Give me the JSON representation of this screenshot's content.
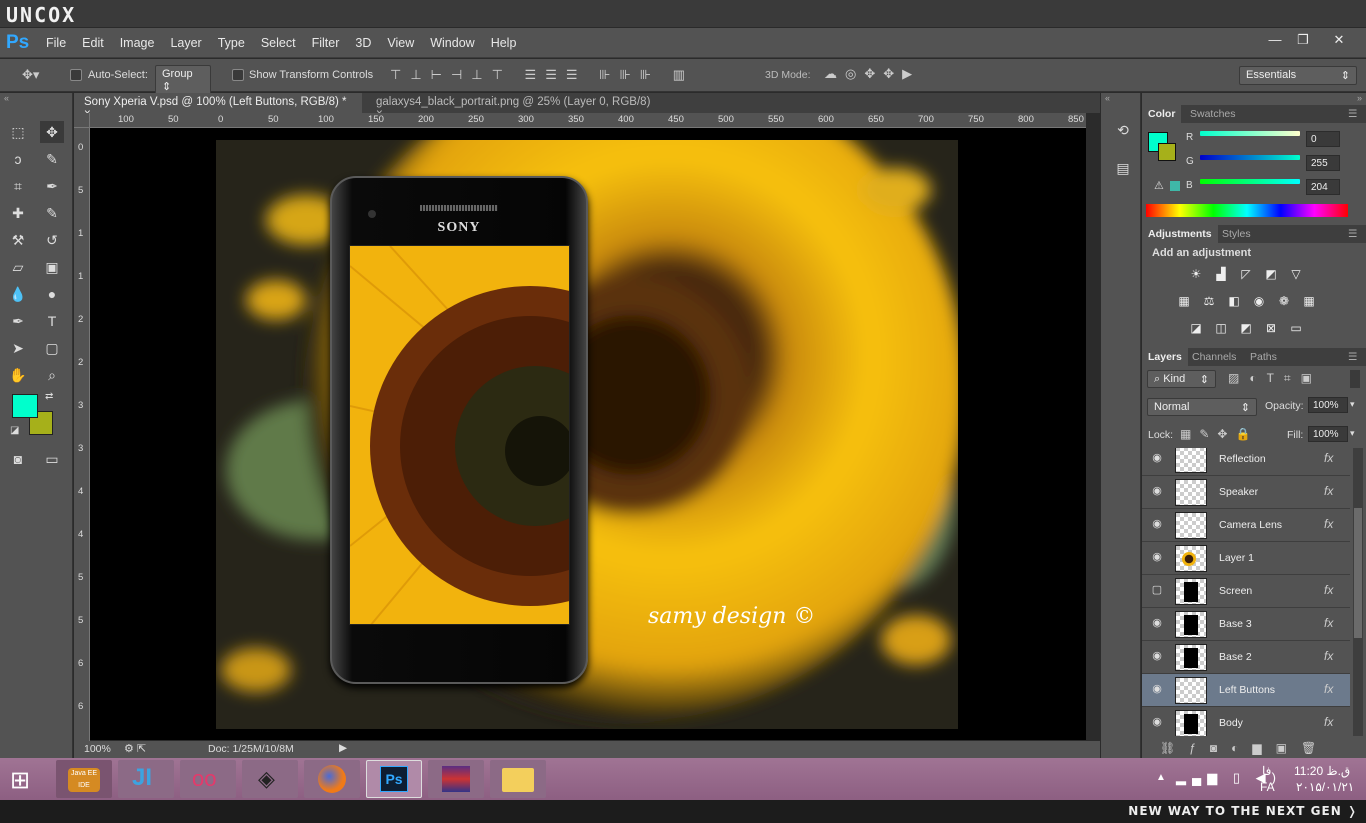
{
  "watermark": {
    "brand": "UNCOX",
    "tagline": "NEW WAY TO THE NEXT GEN"
  },
  "app": {
    "logo": "Ps",
    "menu": [
      "File",
      "Edit",
      "Image",
      "Layer",
      "Type",
      "Select",
      "Filter",
      "3D",
      "View",
      "Window",
      "Help"
    ]
  },
  "options": {
    "auto_select_label": "Auto-Select:",
    "auto_select_value": "Group",
    "transform_label": "Show Transform Controls",
    "mode_3d": "3D Mode:",
    "workspace": "Essentials"
  },
  "tabs": [
    {
      "label": "Sony Xperia V.psd @ 100% (Left Buttons, RGB/8) *"
    },
    {
      "label": "galaxys4_black_portrait.png @ 25% (Layer 0, RGB/8)"
    }
  ],
  "ruler_h": [
    "100",
    "50",
    "0",
    "50",
    "100",
    "150",
    "200",
    "250",
    "300",
    "350",
    "400",
    "450",
    "500",
    "550",
    "600",
    "650",
    "700",
    "750",
    "800",
    "850"
  ],
  "ruler_v": [
    "0",
    "5",
    "1",
    "1",
    "2",
    "2",
    "3",
    "3",
    "4",
    "4",
    "5",
    "5",
    "6",
    "6"
  ],
  "status": {
    "zoom": "100%",
    "doc": "Doc: 1/25M/10/8M"
  },
  "canvas": {
    "phone_brand": "SONY",
    "signature": "samy design ©"
  },
  "color_panel": {
    "tabs": [
      "Color",
      "Swatches"
    ],
    "r_label": "R",
    "g_label": "G",
    "b_label": "B",
    "r": "0",
    "g": "255",
    "b": "204",
    "fg_color": "#00ffcc",
    "bg_color": "#a6b01a"
  },
  "adjust_panel": {
    "tabs": [
      "Adjustments",
      "Styles"
    ],
    "title": "Add an adjustment"
  },
  "layers_panel": {
    "tabs": [
      "Layers",
      "Channels",
      "Paths"
    ],
    "kind": "Kind",
    "blend": "Normal",
    "opacity_label": "Opacity:",
    "opacity": "100%",
    "lock_label": "Lock:",
    "fill_label": "Fill:",
    "fill": "100%",
    "layers": [
      {
        "name": "Reflection",
        "fx": "fx",
        "visible": true
      },
      {
        "name": "Speaker",
        "fx": "fx",
        "visible": true
      },
      {
        "name": "Camera Lens",
        "fx": "fx",
        "visible": true
      },
      {
        "name": "Layer 1",
        "fx": "",
        "visible": true
      },
      {
        "name": "Screen",
        "fx": "fx",
        "visible": false
      },
      {
        "name": "Base 3",
        "fx": "fx",
        "visible": true
      },
      {
        "name": "Base 2",
        "fx": "fx",
        "visible": true
      },
      {
        "name": "Left Buttons",
        "fx": "fx",
        "visible": true
      },
      {
        "name": "Body",
        "fx": "fx",
        "visible": true
      }
    ]
  },
  "taskbar": {
    "time": "11:20 ق.ظ",
    "date": "۲۰۱۵/۰۱/۲۱",
    "lang": "FA",
    "lang_ar": "فا",
    "java_label": "Java EE IDE"
  }
}
